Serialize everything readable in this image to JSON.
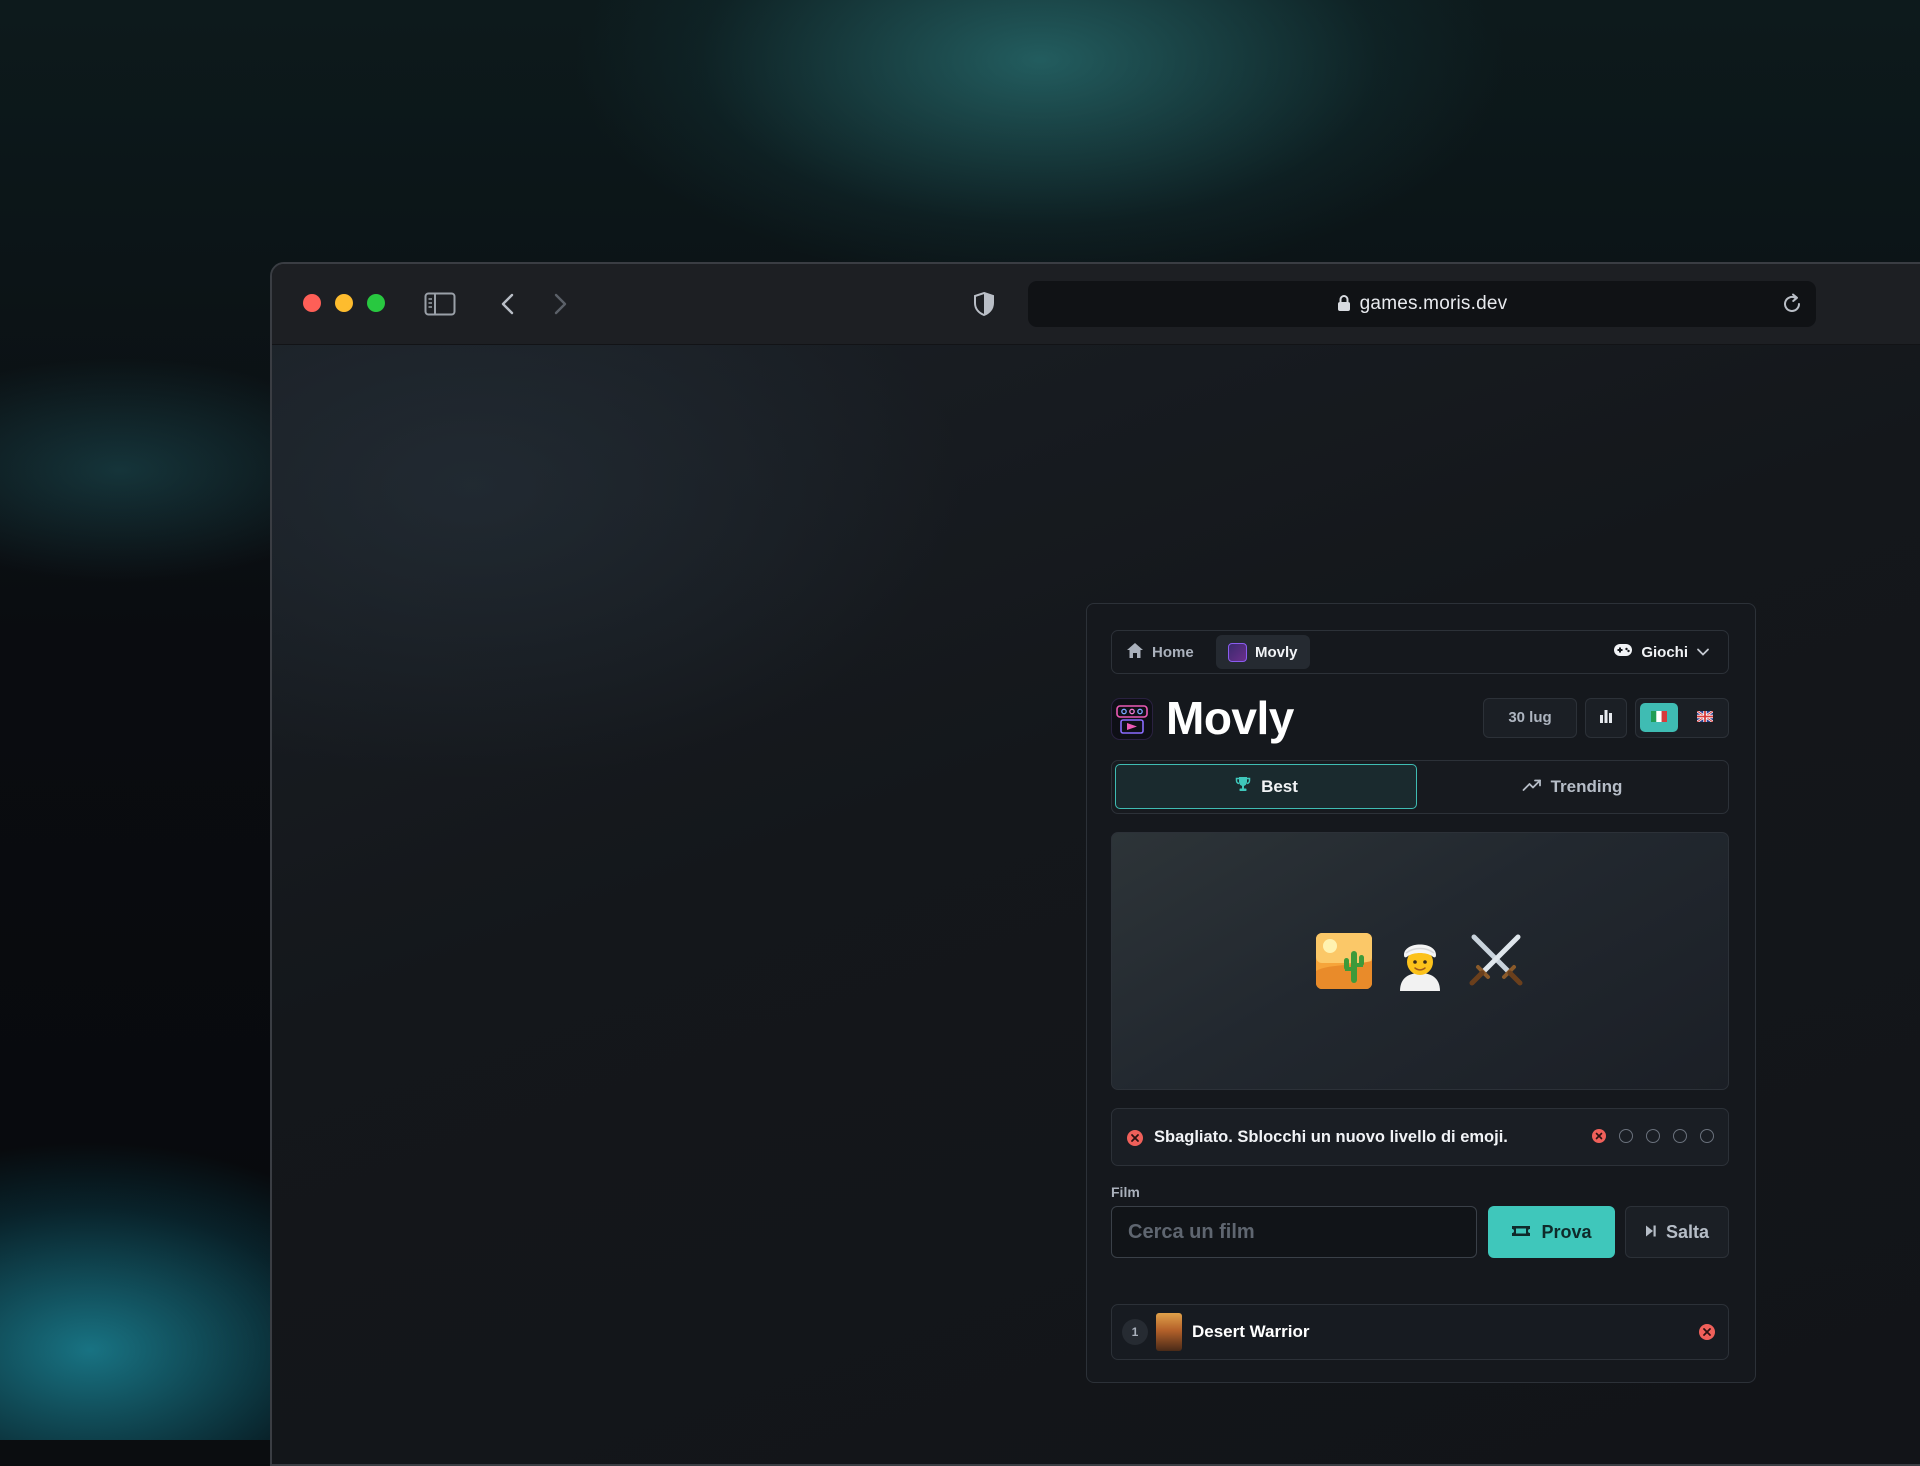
{
  "browser": {
    "url": "games.moris.dev"
  },
  "nav": {
    "home_label": "Home",
    "current_label": "Movly",
    "games_label": "Giochi"
  },
  "header": {
    "title": "Movly",
    "date": "30 lug",
    "languages": [
      {
        "code": "it",
        "flag": "italian-flag-icon",
        "selected": true
      },
      {
        "code": "en",
        "flag": "uk-flag-icon",
        "selected": false
      }
    ]
  },
  "tabs": [
    {
      "label": "Best",
      "icon": "trophy-icon",
      "active": true
    },
    {
      "label": "Trending",
      "icon": "trending-up-icon",
      "active": false
    }
  ],
  "puzzle": {
    "emojis": [
      "desert-emoji",
      "person-turban-emoji",
      "crossed-swords-emoji"
    ]
  },
  "feedback": {
    "message": "Sbagliato. Sblocchi un nuovo livello di emoji.",
    "attempts": [
      "miss",
      "empty",
      "empty",
      "empty",
      "empty"
    ]
  },
  "form": {
    "label": "Film",
    "placeholder": "Cerca un film",
    "value": "",
    "submit_label": "Prova",
    "skip_label": "Salta"
  },
  "guesses": [
    {
      "number": "1",
      "title": "Desert Warrior",
      "result": "wrong"
    }
  ],
  "colors": {
    "accent": "#3fc7bb",
    "error": "#f0605a",
    "card_bg": "#15181d"
  }
}
